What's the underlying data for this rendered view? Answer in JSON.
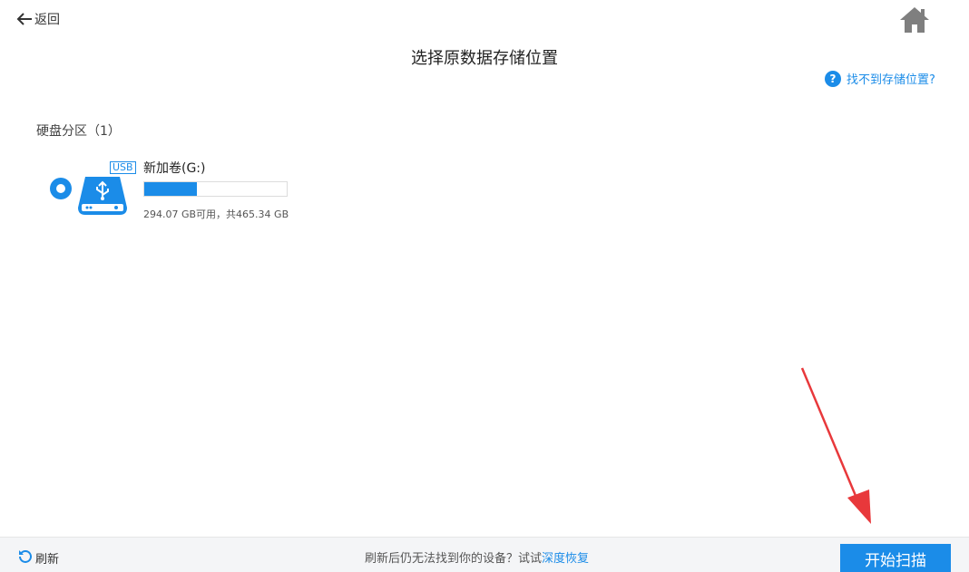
{
  "header": {
    "back_label": "返回",
    "title": "选择原数据存储位置",
    "help_label": "找不到存储位置?"
  },
  "section": {
    "title": "硬盘分区（1）"
  },
  "drives": [
    {
      "tag": "USB",
      "name": "新加卷(G:)",
      "capacity_text": "294.07 GB可用，共465.34 GB",
      "used_fraction": 0.368,
      "selected": true
    }
  ],
  "footer": {
    "refresh_label": "刷新",
    "hint_text": "刷新后仍无法找到你的设备？试试",
    "deep_recovery_label": "深度恢复",
    "start_scan_label": "开始扫描"
  },
  "colors": {
    "accent": "#1b8ce8",
    "annotation": "#e8383b",
    "footer_bg": "#f4f5f7"
  },
  "icons": {
    "back": "arrow-left-icon",
    "home": "home-icon",
    "help": "question-circle-icon",
    "drive": "usb-drive-icon",
    "refresh": "refresh-icon"
  }
}
